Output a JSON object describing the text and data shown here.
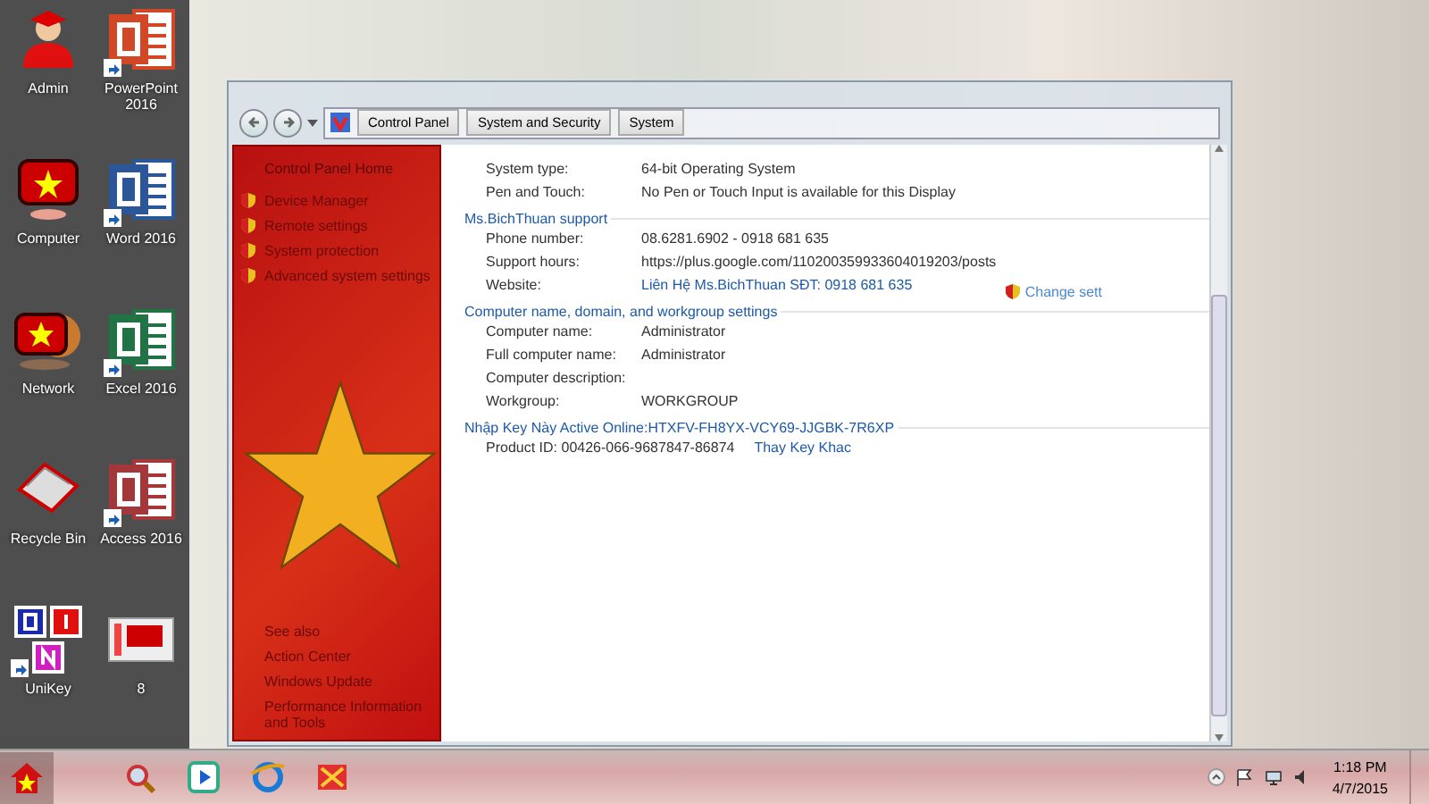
{
  "desktop_icons": [
    {
      "label": "Admin",
      "kind": "admin",
      "shortcut": false
    },
    {
      "label": "Computer",
      "kind": "computer",
      "shortcut": false
    },
    {
      "label": "Network",
      "kind": "network",
      "shortcut": false
    },
    {
      "label": "Recycle Bin",
      "kind": "recycle",
      "shortcut": false
    },
    {
      "label": "UniKey",
      "kind": "unikey",
      "shortcut": true
    },
    {
      "label": "PowerPoint 2016",
      "kind": "powerpoint",
      "shortcut": true
    },
    {
      "label": "Word 2016",
      "kind": "word",
      "shortcut": true
    },
    {
      "label": "Excel 2016",
      "kind": "excel",
      "shortcut": true
    },
    {
      "label": "Access 2016",
      "kind": "access",
      "shortcut": true
    },
    {
      "label": "8",
      "kind": "thumbnail",
      "shortcut": false
    }
  ],
  "window": {
    "breadcrumb": [
      "Control Panel",
      "System and Security",
      "System"
    ],
    "sidebar": {
      "home": "Control Panel Home",
      "tasks": [
        "Device Manager",
        "Remote settings",
        "System protection",
        "Advanced system settings"
      ],
      "see_also_title": "See also",
      "see_also": [
        "Action Center",
        "Windows Update",
        "Performance Information and Tools"
      ]
    },
    "sections": [
      {
        "rows": [
          {
            "label": "System type:",
            "value": "64-bit Operating System",
            "kind": "text"
          },
          {
            "label": "Pen and Touch:",
            "value": "No Pen or Touch Input is available for this Display",
            "kind": "text"
          }
        ]
      },
      {
        "title": "Ms.BichThuan support",
        "rows": [
          {
            "label": "Phone number:",
            "value": "08.6281.6902 - 0918 681 635",
            "kind": "text"
          },
          {
            "label": "Support hours:",
            "value": "https://plus.google.com/110200359933604019203/posts",
            "kind": "text"
          },
          {
            "label": "Website:",
            "value": "Liên Hệ Ms.BichThuan SĐT: 0918 681 635",
            "kind": "link"
          }
        ]
      },
      {
        "title": "Computer name, domain, and workgroup settings",
        "action": "Change sett",
        "rows": [
          {
            "label": "Computer name:",
            "value": "Administrator",
            "kind": "text"
          },
          {
            "label": "Full computer name:",
            "value": "Administrator",
            "kind": "text"
          },
          {
            "label": "Computer description:",
            "kind": "text"
          },
          {
            "label": "Workgroup:",
            "value": "WORKGROUP",
            "kind": "text"
          }
        ]
      },
      {
        "title": "Nhập Key Này Active Online:HTXFV-FH8YX-VCY69-JJGBK-7R6XP",
        "rows": [
          {
            "label": "Product ID:",
            "value": "00426-066-9687847-86874",
            "kind": "inline",
            "link": "Thay Key Khac"
          }
        ]
      }
    ]
  },
  "taskbar": {
    "time": "1:18 PM",
    "date": "4/7/2015"
  }
}
